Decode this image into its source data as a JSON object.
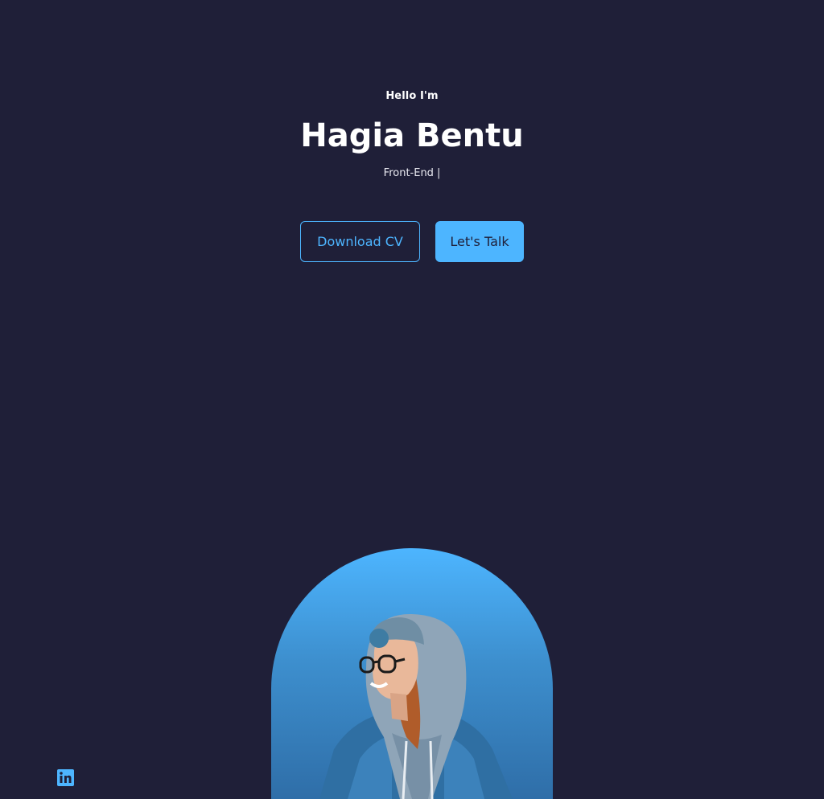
{
  "header": {
    "greeting": "Hello I'm",
    "name": "Hagia Bentu",
    "role": "Front-End",
    "cursor": "|"
  },
  "cta": {
    "download_label": "Download CV",
    "talk_label": "Let's Talk"
  },
  "social": {
    "icons": [
      "linkedin-icon"
    ]
  },
  "colors": {
    "background": "#1f1f38",
    "accent": "#4db5ff",
    "text": "#ffffff"
  }
}
